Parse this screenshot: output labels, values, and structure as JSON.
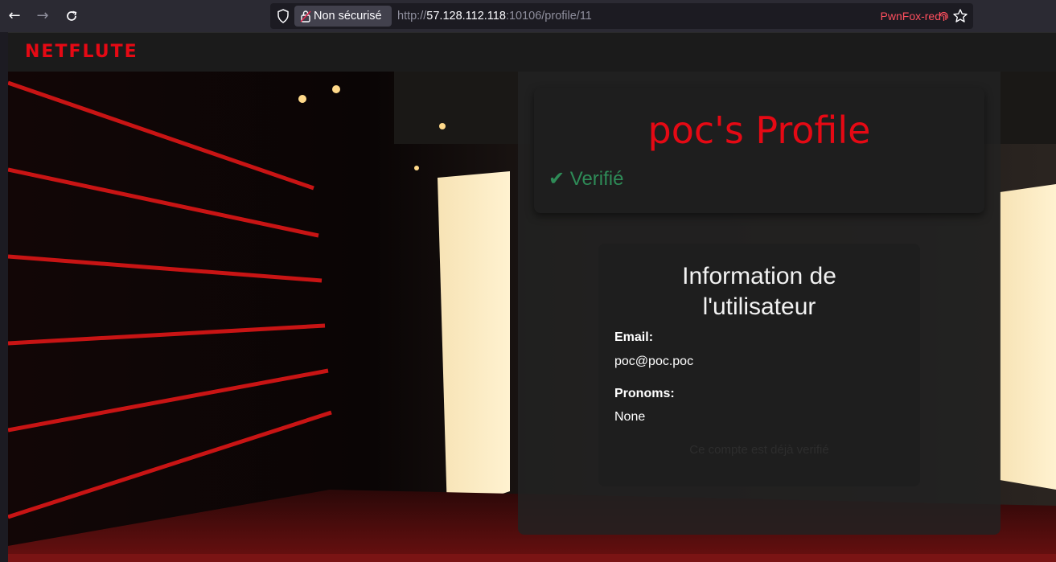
{
  "browser": {
    "security_label": "Non sécurisé",
    "url_scheme": "http://",
    "url_host": "57.128.112.118",
    "url_path": ":10106/profile/11",
    "container_label": "PwnFox-red"
  },
  "site": {
    "logo": "NETFLUTE"
  },
  "profile": {
    "title": "poc's Profile",
    "verified": "✔ Verifié"
  },
  "user_info": {
    "title_line1": "Information de",
    "title_line2": "l'utilisateur",
    "email_label": "Email:",
    "email_value": "poc@poc.poc",
    "pronouns_label": "Pronoms:",
    "pronouns_value": "None",
    "note": "Ce compte est déjà verifié"
  },
  "colors": {
    "brand": "#e50914",
    "verified": "#2e8b57",
    "container": "#ff4f5e"
  }
}
